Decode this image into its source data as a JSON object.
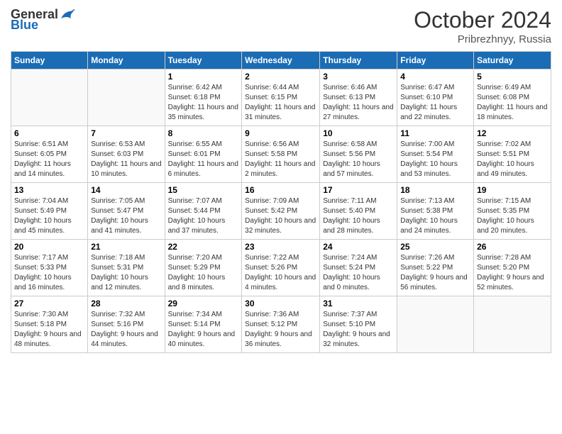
{
  "header": {
    "logo_general": "General",
    "logo_blue": "Blue",
    "month_year": "October 2024",
    "location": "Pribrezhnyy, Russia"
  },
  "days_of_week": [
    "Sunday",
    "Monday",
    "Tuesday",
    "Wednesday",
    "Thursday",
    "Friday",
    "Saturday"
  ],
  "weeks": [
    [
      {
        "num": "",
        "sunrise": "",
        "sunset": "",
        "daylight": ""
      },
      {
        "num": "",
        "sunrise": "",
        "sunset": "",
        "daylight": ""
      },
      {
        "num": "1",
        "sunrise": "Sunrise: 6:42 AM",
        "sunset": "Sunset: 6:18 PM",
        "daylight": "Daylight: 11 hours and 35 minutes."
      },
      {
        "num": "2",
        "sunrise": "Sunrise: 6:44 AM",
        "sunset": "Sunset: 6:15 PM",
        "daylight": "Daylight: 11 hours and 31 minutes."
      },
      {
        "num": "3",
        "sunrise": "Sunrise: 6:46 AM",
        "sunset": "Sunset: 6:13 PM",
        "daylight": "Daylight: 11 hours and 27 minutes."
      },
      {
        "num": "4",
        "sunrise": "Sunrise: 6:47 AM",
        "sunset": "Sunset: 6:10 PM",
        "daylight": "Daylight: 11 hours and 22 minutes."
      },
      {
        "num": "5",
        "sunrise": "Sunrise: 6:49 AM",
        "sunset": "Sunset: 6:08 PM",
        "daylight": "Daylight: 11 hours and 18 minutes."
      }
    ],
    [
      {
        "num": "6",
        "sunrise": "Sunrise: 6:51 AM",
        "sunset": "Sunset: 6:05 PM",
        "daylight": "Daylight: 11 hours and 14 minutes."
      },
      {
        "num": "7",
        "sunrise": "Sunrise: 6:53 AM",
        "sunset": "Sunset: 6:03 PM",
        "daylight": "Daylight: 11 hours and 10 minutes."
      },
      {
        "num": "8",
        "sunrise": "Sunrise: 6:55 AM",
        "sunset": "Sunset: 6:01 PM",
        "daylight": "Daylight: 11 hours and 6 minutes."
      },
      {
        "num": "9",
        "sunrise": "Sunrise: 6:56 AM",
        "sunset": "Sunset: 5:58 PM",
        "daylight": "Daylight: 11 hours and 2 minutes."
      },
      {
        "num": "10",
        "sunrise": "Sunrise: 6:58 AM",
        "sunset": "Sunset: 5:56 PM",
        "daylight": "Daylight: 10 hours and 57 minutes."
      },
      {
        "num": "11",
        "sunrise": "Sunrise: 7:00 AM",
        "sunset": "Sunset: 5:54 PM",
        "daylight": "Daylight: 10 hours and 53 minutes."
      },
      {
        "num": "12",
        "sunrise": "Sunrise: 7:02 AM",
        "sunset": "Sunset: 5:51 PM",
        "daylight": "Daylight: 10 hours and 49 minutes."
      }
    ],
    [
      {
        "num": "13",
        "sunrise": "Sunrise: 7:04 AM",
        "sunset": "Sunset: 5:49 PM",
        "daylight": "Daylight: 10 hours and 45 minutes."
      },
      {
        "num": "14",
        "sunrise": "Sunrise: 7:05 AM",
        "sunset": "Sunset: 5:47 PM",
        "daylight": "Daylight: 10 hours and 41 minutes."
      },
      {
        "num": "15",
        "sunrise": "Sunrise: 7:07 AM",
        "sunset": "Sunset: 5:44 PM",
        "daylight": "Daylight: 10 hours and 37 minutes."
      },
      {
        "num": "16",
        "sunrise": "Sunrise: 7:09 AM",
        "sunset": "Sunset: 5:42 PM",
        "daylight": "Daylight: 10 hours and 32 minutes."
      },
      {
        "num": "17",
        "sunrise": "Sunrise: 7:11 AM",
        "sunset": "Sunset: 5:40 PM",
        "daylight": "Daylight: 10 hours and 28 minutes."
      },
      {
        "num": "18",
        "sunrise": "Sunrise: 7:13 AM",
        "sunset": "Sunset: 5:38 PM",
        "daylight": "Daylight: 10 hours and 24 minutes."
      },
      {
        "num": "19",
        "sunrise": "Sunrise: 7:15 AM",
        "sunset": "Sunset: 5:35 PM",
        "daylight": "Daylight: 10 hours and 20 minutes."
      }
    ],
    [
      {
        "num": "20",
        "sunrise": "Sunrise: 7:17 AM",
        "sunset": "Sunset: 5:33 PM",
        "daylight": "Daylight: 10 hours and 16 minutes."
      },
      {
        "num": "21",
        "sunrise": "Sunrise: 7:18 AM",
        "sunset": "Sunset: 5:31 PM",
        "daylight": "Daylight: 10 hours and 12 minutes."
      },
      {
        "num": "22",
        "sunrise": "Sunrise: 7:20 AM",
        "sunset": "Sunset: 5:29 PM",
        "daylight": "Daylight: 10 hours and 8 minutes."
      },
      {
        "num": "23",
        "sunrise": "Sunrise: 7:22 AM",
        "sunset": "Sunset: 5:26 PM",
        "daylight": "Daylight: 10 hours and 4 minutes."
      },
      {
        "num": "24",
        "sunrise": "Sunrise: 7:24 AM",
        "sunset": "Sunset: 5:24 PM",
        "daylight": "Daylight: 10 hours and 0 minutes."
      },
      {
        "num": "25",
        "sunrise": "Sunrise: 7:26 AM",
        "sunset": "Sunset: 5:22 PM",
        "daylight": "Daylight: 9 hours and 56 minutes."
      },
      {
        "num": "26",
        "sunrise": "Sunrise: 7:28 AM",
        "sunset": "Sunset: 5:20 PM",
        "daylight": "Daylight: 9 hours and 52 minutes."
      }
    ],
    [
      {
        "num": "27",
        "sunrise": "Sunrise: 7:30 AM",
        "sunset": "Sunset: 5:18 PM",
        "daylight": "Daylight: 9 hours and 48 minutes."
      },
      {
        "num": "28",
        "sunrise": "Sunrise: 7:32 AM",
        "sunset": "Sunset: 5:16 PM",
        "daylight": "Daylight: 9 hours and 44 minutes."
      },
      {
        "num": "29",
        "sunrise": "Sunrise: 7:34 AM",
        "sunset": "Sunset: 5:14 PM",
        "daylight": "Daylight: 9 hours and 40 minutes."
      },
      {
        "num": "30",
        "sunrise": "Sunrise: 7:36 AM",
        "sunset": "Sunset: 5:12 PM",
        "daylight": "Daylight: 9 hours and 36 minutes."
      },
      {
        "num": "31",
        "sunrise": "Sunrise: 7:37 AM",
        "sunset": "Sunset: 5:10 PM",
        "daylight": "Daylight: 9 hours and 32 minutes."
      },
      {
        "num": "",
        "sunrise": "",
        "sunset": "",
        "daylight": ""
      },
      {
        "num": "",
        "sunrise": "",
        "sunset": "",
        "daylight": ""
      }
    ]
  ]
}
